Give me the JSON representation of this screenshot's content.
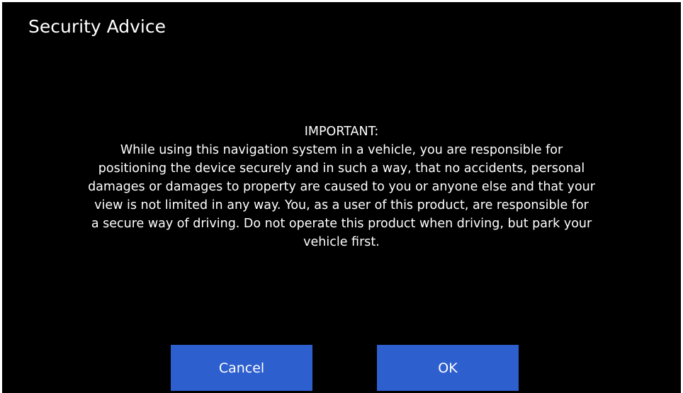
{
  "dialog": {
    "title": "Security Advice",
    "message_lines": [
      "IMPORTANT:",
      "While using this navigation system in a vehicle, you are responsible for",
      "positioning the device securely and in such a way, that no accidents, personal",
      "damages or damages to property are caused to you or anyone else and that your",
      "view is not limited in any way. You, as a user of this product, are responsible for",
      "a secure way of driving. Do not operate this product when driving, but park your",
      "vehicle first."
    ],
    "buttons": {
      "cancel_label": "Cancel",
      "ok_label": "OK"
    }
  },
  "colors": {
    "background": "#000000",
    "text": "#ffffff",
    "button": "#2e5fcf"
  }
}
